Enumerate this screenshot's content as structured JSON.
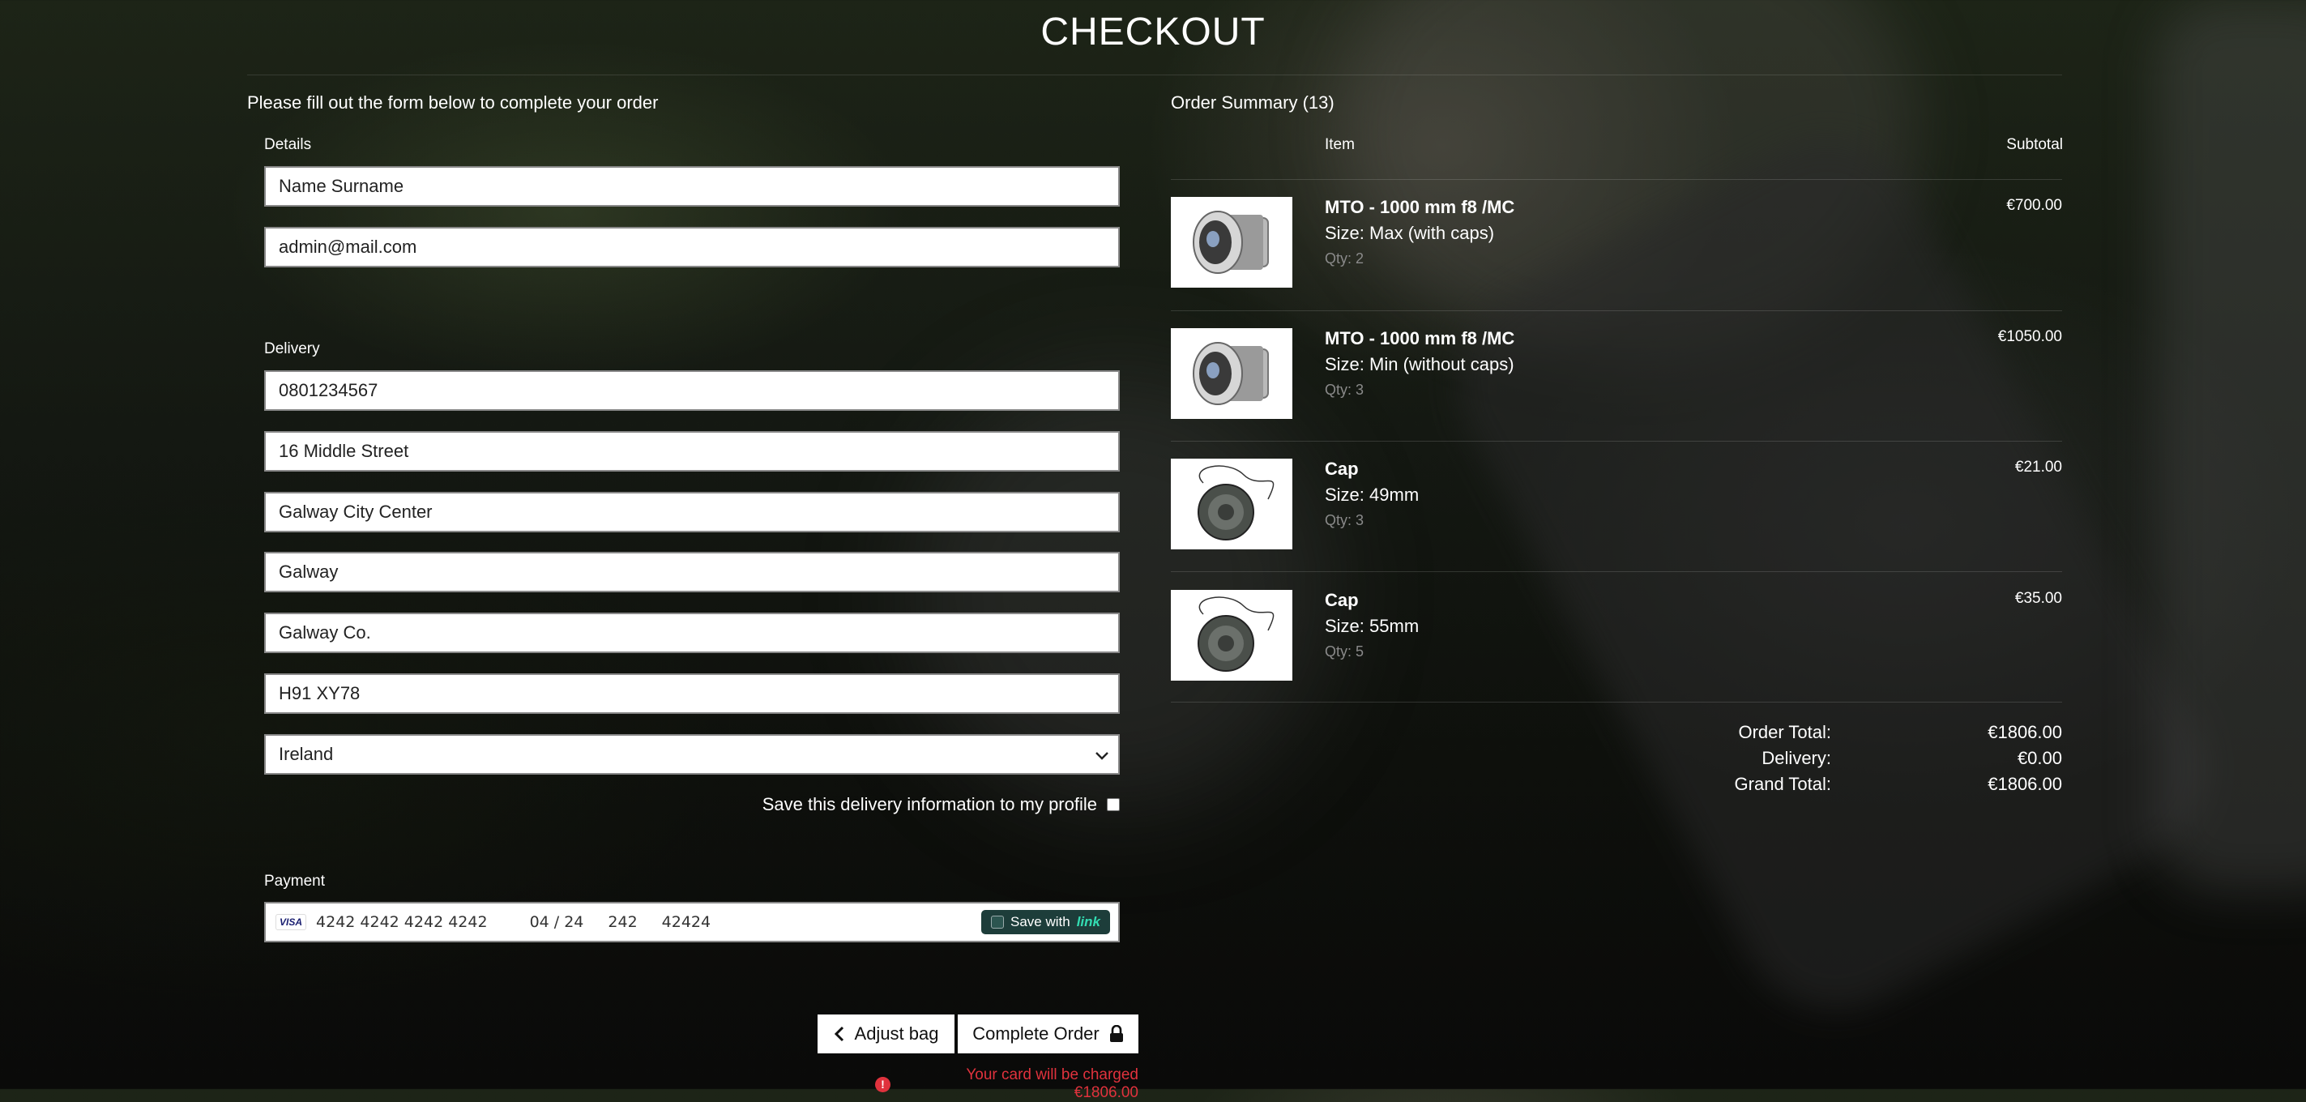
{
  "page": {
    "title": "CHECKOUT"
  },
  "form": {
    "intro": "Please fill out the form below to complete your order",
    "details_label": "Details",
    "full_name": "Name Surname",
    "email": "admin@mail.com",
    "delivery_label": "Delivery",
    "phone": "0801234567",
    "street1": "16 Middle Street",
    "street2": "Galway City Center",
    "town": "Galway",
    "county": "Galway Co.",
    "postcode": "H91 XY78",
    "country": "Ireland",
    "save_info_label": "Save this delivery information to my profile",
    "payment_label": "Payment",
    "card": {
      "brand": "VISA",
      "number": "4242 4242 4242 4242",
      "expiry": "04 / 24",
      "cvc": "242",
      "zip": "42424",
      "save_with": "Save with",
      "link_brand": "link"
    },
    "adjust_bag": "Adjust bag",
    "complete_order": "Complete Order",
    "charge_note": "Your card will be charged €1806.00"
  },
  "summary": {
    "title": "Order Summary (13)",
    "col_item": "Item",
    "col_subtotal": "Subtotal",
    "items": [
      {
        "name": "MTO - 1000 mm f8 /MC",
        "size": "Size: Max (with caps)",
        "qty": "Qty: 2",
        "subtotal": "€700.00",
        "image": "lens"
      },
      {
        "name": "MTO - 1000 mm f8 /MC",
        "size": "Size: Min (without caps)",
        "qty": "Qty: 3",
        "subtotal": "€1050.00",
        "image": "lens"
      },
      {
        "name": "Cap",
        "size": "Size: 49mm",
        "qty": "Qty: 3",
        "subtotal": "€21.00",
        "image": "lens-cap"
      },
      {
        "name": "Cap",
        "size": "Size: 55mm",
        "qty": "Qty: 5",
        "subtotal": "€35.00",
        "image": "lens-cap"
      }
    ],
    "order_total_label": "Order Total:",
    "order_total": "€1806.00",
    "delivery_label": "Delivery:",
    "delivery": "€0.00",
    "grand_total_label": "Grand Total:",
    "grand_total": "€1806.00"
  },
  "colors": {
    "error": "#e0323d",
    "link_accent": "#33ddb3"
  }
}
